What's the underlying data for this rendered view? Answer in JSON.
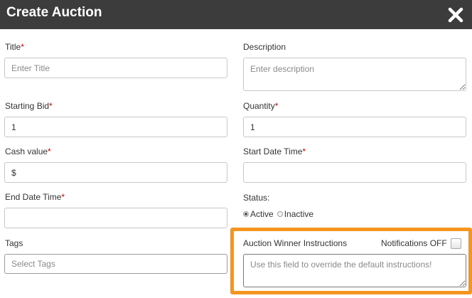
{
  "header": {
    "title": "Create Auction",
    "close_icon": "close-icon"
  },
  "required_marker": "*",
  "fields": {
    "title": {
      "label": "Title",
      "placeholder": "Enter Title",
      "value": ""
    },
    "description": {
      "label": "Description",
      "placeholder": "Enter description",
      "value": ""
    },
    "starting_bid": {
      "label": "Starting Bid",
      "value": "1"
    },
    "quantity": {
      "label": "Quantity",
      "value": "1"
    },
    "cash_value": {
      "label": "Cash value",
      "value": "$"
    },
    "start_date_time": {
      "label": "Start Date Time",
      "value": ""
    },
    "end_date_time": {
      "label": "End Date Time",
      "value": ""
    },
    "status": {
      "label": "Status:",
      "options": [
        "Active",
        "Inactive"
      ],
      "selected": "Active"
    },
    "tags": {
      "label": "Tags",
      "placeholder": "Select Tags",
      "value": ""
    },
    "winner_instructions": {
      "label": "Auction Winner Instructions",
      "placeholder": "Use this field to override the default instructions!",
      "value": ""
    },
    "notifications": {
      "label": "Notifications OFF",
      "checked": false
    }
  },
  "colors": {
    "header_bg": "#3c3c3c",
    "required": "#cc0000",
    "highlight": "#f5951f"
  }
}
